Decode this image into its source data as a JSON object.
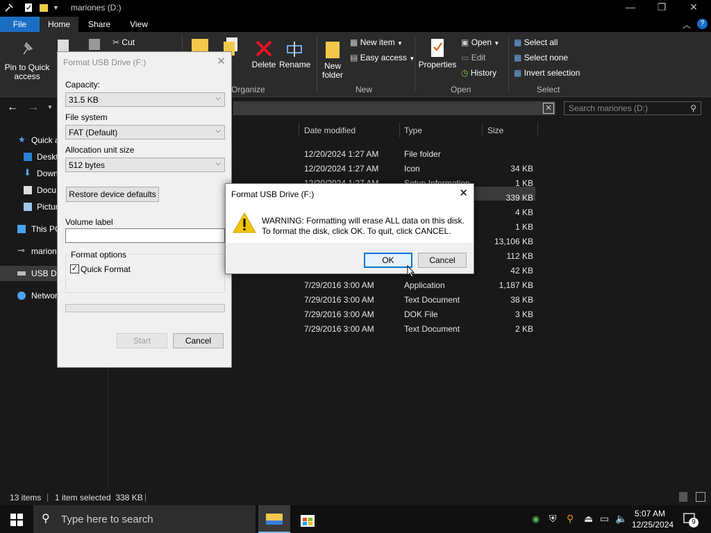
{
  "window": {
    "title": "mariones (D:)"
  },
  "tabs": [
    {
      "label": "File"
    },
    {
      "label": "Home"
    },
    {
      "label": "Share"
    },
    {
      "label": "View"
    }
  ],
  "ribbon": {
    "clipboard": {
      "pin": "Pin to Quick access",
      "cut": "Cut",
      "copy_partial": "C"
    },
    "organize": {
      "copy_to_partial": "y",
      "delete": "Delete",
      "rename": "Rename",
      "label": "Organize"
    },
    "new": {
      "new_item": "New item",
      "easy_access": "Easy access",
      "new_folder": "New folder",
      "label": "New"
    },
    "open": {
      "properties": "Properties",
      "open": "Open",
      "edit": "Edit",
      "history": "History",
      "label": "Open"
    },
    "select": {
      "select_all": "Select all",
      "select_none": "Select none",
      "invert": "Invert selection",
      "label": "Select"
    }
  },
  "search": {
    "placeholder": "Search mariones (D:)"
  },
  "nav": [
    {
      "label": "Quick a"
    },
    {
      "label": "Deskt"
    },
    {
      "label": "Down"
    },
    {
      "label": "Docu"
    },
    {
      "label": "Pictur"
    },
    {
      "label": "This PC"
    },
    {
      "label": "marion"
    },
    {
      "label": "USB Dri"
    },
    {
      "label": "Networ"
    }
  ],
  "columns": {
    "date": "Date modified",
    "type": "Type",
    "size": "Size"
  },
  "rows": [
    {
      "date": "12/20/2024 1:27 AM",
      "type": "File folder",
      "size": ""
    },
    {
      "date": "12/20/2024 1:27 AM",
      "type": "Icon",
      "size": "34 KB"
    },
    {
      "date": "12/20/2024 1:27 AM",
      "type": "Setup Information",
      "size": "1 KB"
    },
    {
      "date": "",
      "type": "",
      "size": "339 KB"
    },
    {
      "date": "",
      "type": "",
      "size": "4 KB"
    },
    {
      "date": "",
      "type": "",
      "size": "1 KB"
    },
    {
      "date": "",
      "type": "",
      "size": "13,106 KB"
    },
    {
      "date": "",
      "type": "",
      "size": "112 KB"
    },
    {
      "date": "",
      "type": "",
      "size": "42 KB"
    },
    {
      "date": "7/29/2016 3:00 AM",
      "type": "Application",
      "size": "1,187 KB"
    },
    {
      "date": "7/29/2016 3:00 AM",
      "type": "Text Document",
      "size": "38 KB"
    },
    {
      "date": "7/29/2016 3:00 AM",
      "type": "DOK File",
      "size": "3 KB"
    },
    {
      "date": "7/29/2016 3:00 AM",
      "type": "Text Document",
      "size": "2 KB"
    }
  ],
  "status": {
    "items": "13 items",
    "selected": "1 item selected  338 KB"
  },
  "format_dialog": {
    "title": "Format USB Drive (F:)",
    "capacity_label": "Capacity:",
    "capacity_value": "31.5 KB",
    "fs_label": "File system",
    "fs_value": "FAT (Default)",
    "alloc_label": "Allocation unit size",
    "alloc_value": "512 bytes",
    "restore": "Restore device defaults",
    "volume_label": "Volume label",
    "volume_value": "",
    "options_label": "Format options",
    "quick_format": "Quick Format",
    "start": "Start",
    "cancel": "Cancel"
  },
  "warning_dialog": {
    "title": "Format USB Drive (F:)",
    "line1": "WARNING: Formatting will erase ALL data on this disk.",
    "line2": "To format the disk, click OK. To quit, click CANCEL.",
    "ok": "OK",
    "cancel": "Cancel"
  },
  "taskbar": {
    "search_placeholder": "Type here to search",
    "time": "5:07 AM",
    "date": "12/25/2024",
    "notif_count": "9"
  },
  "help_badge": "?"
}
